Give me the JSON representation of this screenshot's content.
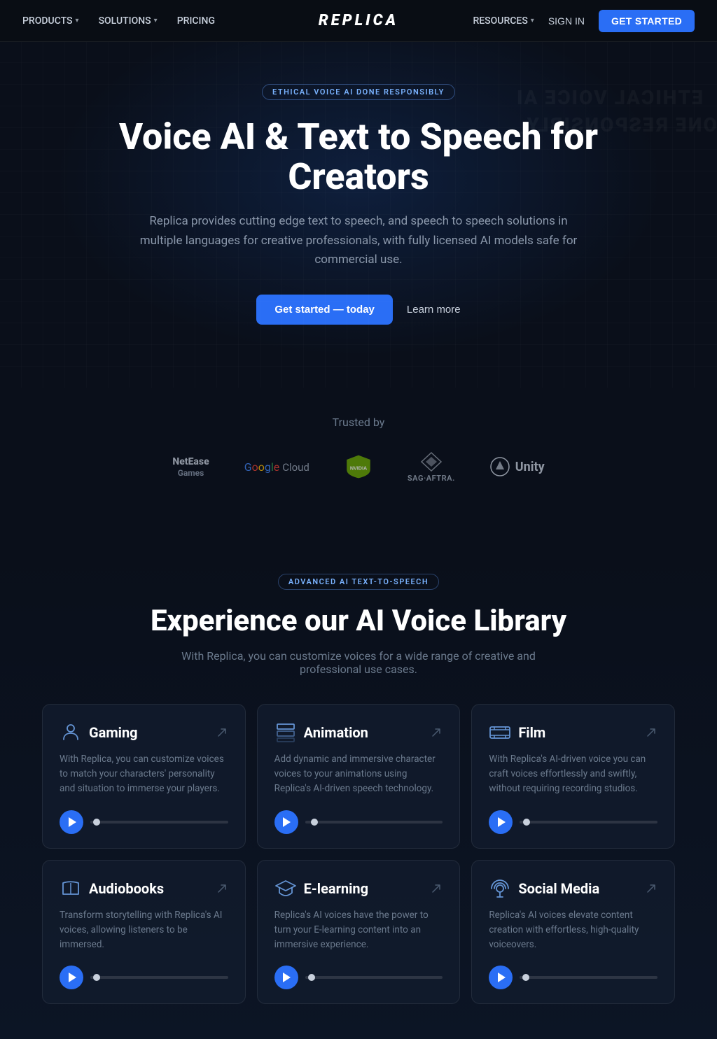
{
  "nav": {
    "logo": "REPLICA",
    "left_items": [
      {
        "label": "PRODUCTS",
        "has_chevron": true
      },
      {
        "label": "SOLUTIONS",
        "has_chevron": true
      },
      {
        "label": "PRICING",
        "has_chevron": false
      }
    ],
    "right_items": [
      {
        "label": "RESOURCES",
        "has_chevron": true
      },
      {
        "label": "SIGN IN",
        "has_chevron": false
      }
    ],
    "cta_label": "GET STARTED"
  },
  "hero": {
    "badge": "ETHICAL VOICE AI DONE RESPONSIBLY",
    "title": "Voice AI & Text to Speech for Creators",
    "subtitle": "Replica provides cutting edge text to speech, and speech to speech solutions in multiple languages for creative professionals, with fully licensed AI models safe for commercial use.",
    "cta_primary": "Get started — today",
    "cta_secondary": "Learn more",
    "watermark_line1": "ETHICAL VOICE AI",
    "watermark_line2": "DONE RESPONSIBLY_"
  },
  "trusted": {
    "label": "Trusted by",
    "logos": [
      {
        "name": "NetEase Games",
        "style": "netease"
      },
      {
        "name": "Google Cloud",
        "style": "google"
      },
      {
        "name": "NVIDIA",
        "style": "nvidia"
      },
      {
        "name": "SAG·AFTRA.",
        "style": "sagaftra"
      },
      {
        "name": "Unity",
        "style": "unity"
      }
    ]
  },
  "voice_library": {
    "badge": "ADVANCED AI TEXT-TO-SPEECH",
    "title": "Experience our AI Voice Library",
    "subtitle": "With Replica, you can customize voices for a wide range of creative and professional use cases.",
    "cards": [
      {
        "id": "gaming",
        "icon_type": "person",
        "title": "Gaming",
        "desc": "With Replica, you can customize voices to match your characters' personality and situation to immerse your players."
      },
      {
        "id": "animation",
        "icon_type": "layers",
        "title": "Animation",
        "desc": "Add dynamic and immersive character voices to your animations using Replica's AI-driven speech technology."
      },
      {
        "id": "film",
        "icon_type": "film",
        "title": "Film",
        "desc": "With Replica's AI-driven voice you can craft voices effortlessly and swiftly, without requiring recording studios."
      },
      {
        "id": "audiobooks",
        "icon_type": "book",
        "title": "Audiobooks",
        "desc": "Transform storytelling with Replica's AI voices, allowing listeners to be immersed."
      },
      {
        "id": "elearning",
        "icon_type": "cap",
        "title": "E-learning",
        "desc": "Replica's AI voices have the power to turn your E-learning content into an immersive experience."
      },
      {
        "id": "socialmedia",
        "icon_type": "podcast",
        "title": "Social Media",
        "desc": "Replica's AI voices elevate content creation with effortless, high-quality voiceovers."
      }
    ]
  }
}
